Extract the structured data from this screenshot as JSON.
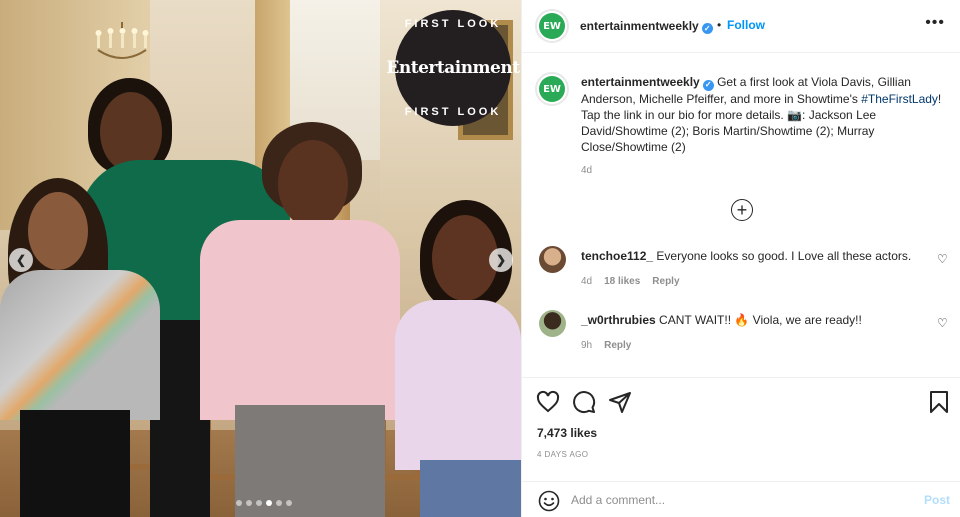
{
  "post": {
    "badge": {
      "ring_top": "FIRST LOOK",
      "brand": "Entertainment",
      "ring_bottom": "FIRST LOOK"
    },
    "carousel": {
      "slide_count": 6,
      "active_index": 3
    }
  },
  "header": {
    "avatar_text": "EW",
    "username": "entertainmentweekly",
    "separator": "•",
    "follow_label": "Follow",
    "more_icon": "more-horizontal-icon"
  },
  "caption": {
    "avatar_text": "EW",
    "username": "entertainmentweekly",
    "text_before": "Get a first look at Viola Davis, Gillian Anderson, Michelle Pfeiffer, and more in Showtime's ",
    "hashtag": "#TheFirstLady",
    "text_after": "! Tap the link in our bio for more details. 📷: Jackson Lee David/Showtime (2); Boris Martin/Showtime (2); Murray Close/Showtime (2)",
    "time": "4d"
  },
  "comments": [
    {
      "username": "tenchoe112_",
      "text": "Everyone looks so good. I Love all these actors.",
      "time": "4d",
      "likes": "18 likes",
      "reply": "Reply"
    },
    {
      "username": "_w0rthrubies",
      "text": "CANT WAIT!! 🔥 Viola, we are ready!!",
      "time": "9h",
      "reply": "Reply"
    }
  ],
  "actions": {
    "likes": "7,473 likes",
    "date": "4 DAYS AGO"
  },
  "add_comment": {
    "placeholder": "Add a comment...",
    "post_label": "Post"
  },
  "colors": {
    "accent": "#0095f6",
    "brand_green": "#2aa957",
    "post_disabled": "#b2dffc"
  }
}
